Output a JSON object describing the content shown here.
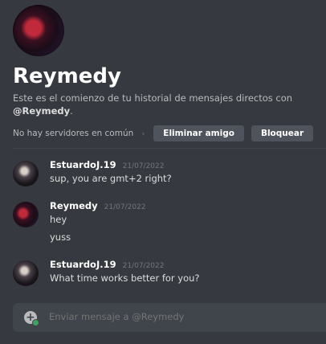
{
  "header": {
    "title": "Reymedy",
    "intro_prefix": "Este es el comienzo de tu historial de mensajes directos con ",
    "intro_user": "@Reymedy",
    "intro_suffix": ".",
    "no_servers": "No hay servidores en común",
    "remove_friend_label": "Eliminar amigo",
    "block_label": "Bloquear"
  },
  "messages": [
    {
      "author": "EstuardoJ.19",
      "time": "21/07/2022",
      "lines": [
        "sup, you are gmt+2 right?"
      ]
    },
    {
      "author": "Reymedy",
      "time": "21/07/2022",
      "lines": [
        "hey",
        "yuss"
      ]
    },
    {
      "author": "EstuardoJ.19",
      "time": "21/07/2022",
      "lines": [
        "What time works better for you?"
      ]
    }
  ],
  "composer": {
    "placeholder": "Enviar mensaje a @Reymedy"
  },
  "colors": {
    "background": "#36393f",
    "button": "#4f545c",
    "composer": "#40444b",
    "online_green": "#3ba55d"
  }
}
